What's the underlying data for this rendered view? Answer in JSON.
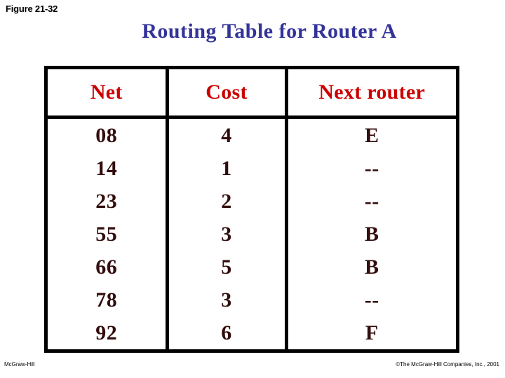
{
  "figure": {
    "label": "Figure 21-32"
  },
  "title": {
    "text": "Routing Table for Router A",
    "color": "#333399"
  },
  "footer": {
    "left": "McGraw-Hill",
    "right": "©The McGraw-Hill Companies, Inc., 2001"
  },
  "colors": {
    "header_text": "#CC0000",
    "data_text": "#330D0D",
    "border": "#000000",
    "title": "#333399",
    "background": "#FFFFFF"
  },
  "table": {
    "headers": [
      "Net",
      "Cost",
      "Next router"
    ],
    "rows": [
      {
        "net": "08",
        "cost": "4",
        "next_router": "E"
      },
      {
        "net": "14",
        "cost": "1",
        "next_router": "--"
      },
      {
        "net": "23",
        "cost": "2",
        "next_router": "--"
      },
      {
        "net": "55",
        "cost": "3",
        "next_router": "B"
      },
      {
        "net": "66",
        "cost": "5",
        "next_router": "B"
      },
      {
        "net": "78",
        "cost": "3",
        "next_router": "--"
      },
      {
        "net": "92",
        "cost": "6",
        "next_router": "F"
      }
    ]
  }
}
